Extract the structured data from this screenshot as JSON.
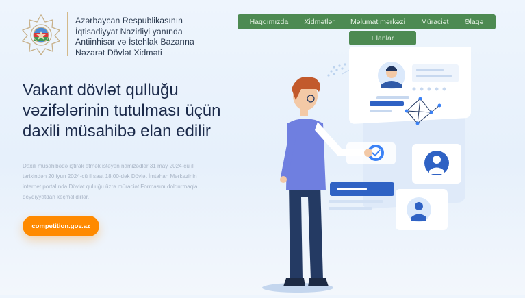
{
  "header": {
    "org_name": "Azərbaycan Respublikasının\nİqtisadiyyat Nazirliyi yanında\nAntiinhisar və İstehlak Bazarına\nNəzarət Dövlət Xidməti"
  },
  "nav": {
    "items": [
      "Haqqımızda",
      "Xidmətlər",
      "Məlumat mərkəzi",
      "Müraciət",
      "Əlaqə"
    ],
    "second_row": [
      "Elanlar"
    ]
  },
  "hero": {
    "title": "Vakant dövlət qulluğu vəzifələrinin tutulması üçün daxili müsahibə elan edilir",
    "description": "Daxili müsahibədə iştirak etmək istəyən namizədlər 31 may 2024-cü il tarixindən 20 iyun 2024-cü il saat 18:00-dək Dövlət İmtahan Mərkəzinin internet portalında Dövlət qulluğu üzrə müraciət Formasını doldurmaqla qeydiyyatdan keçməlidirlər.",
    "cta_label": "competition.gov.az"
  },
  "colors": {
    "nav_green": "#4d8a52",
    "cta_orange": "#ff8a00",
    "heading": "#1b2a4a",
    "accent_blue": "#3b82f6"
  }
}
